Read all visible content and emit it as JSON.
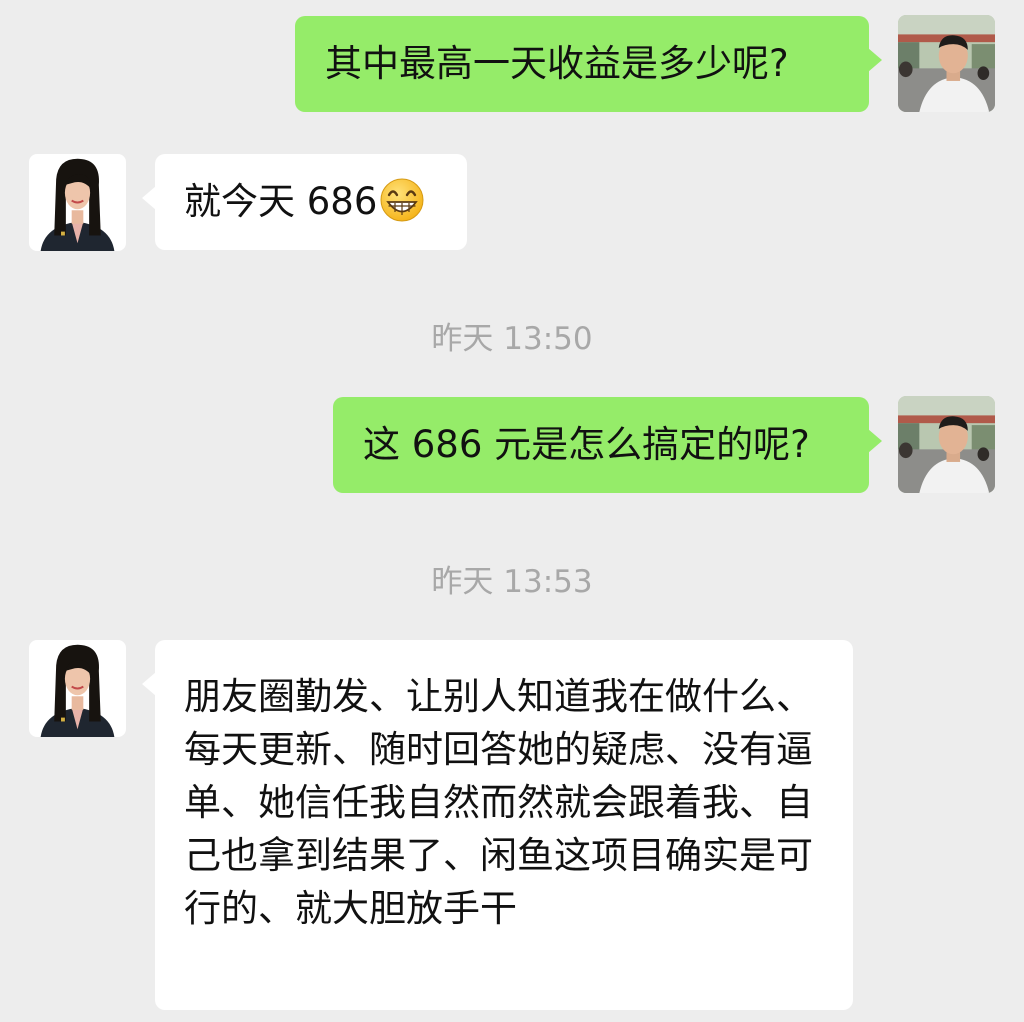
{
  "messages": [
    {
      "sender": "me",
      "text": "其中最高一天收益是多少呢?"
    },
    {
      "sender": "them",
      "text": "就今天 686",
      "emoji": "grinning-face-emoji"
    },
    {
      "timestamp": "昨天 13:50"
    },
    {
      "sender": "me",
      "text": "这 686 元是怎么搞定的呢?"
    },
    {
      "timestamp": "昨天 13:53"
    },
    {
      "sender": "them",
      "text": "朋友圈勤发、让别人知道我在做什么、每天更新、随时回答她的疑虑、没有逼单、她信任我自然而然就会跟着我、自己也拿到结果了、闲鱼这项目确实是可行的、就大胆放手干"
    }
  ],
  "colors": {
    "background": "#ededed",
    "my_bubble": "#95ec69",
    "their_bubble": "#ffffff",
    "timestamp_text": "#a8a8a8"
  },
  "icons": {
    "my_avatar": "man-avatar-photo",
    "their_avatar": "woman-avatar-photo"
  }
}
